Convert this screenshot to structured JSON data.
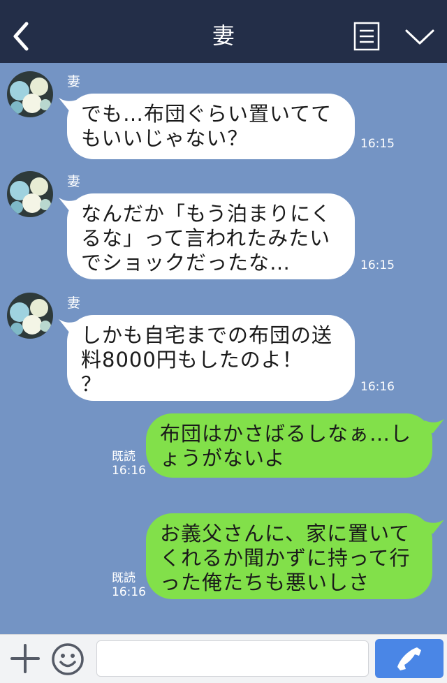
{
  "header": {
    "title": "妻",
    "back_icon": "chevron-left-icon",
    "menu_icon": "notes-menu-icon",
    "expand_icon": "chevron-down-icon"
  },
  "messages": [
    {
      "direction": "incoming",
      "sender": "妻",
      "text": "でも…布団ぐらい置いてて\nもいいじゃない？",
      "time": "16:15"
    },
    {
      "direction": "incoming",
      "sender": "妻",
      "text": "なんだか「もう泊まりにく\nるな」って言われたみたい\nでショックだったな…",
      "time": "16:15"
    },
    {
      "direction": "incoming",
      "sender": "妻",
      "text": "しかも自宅までの布団の送\n料8000円もしたのよ！\n？",
      "time": "16:16"
    },
    {
      "direction": "outgoing",
      "read": "既読",
      "text": "布団はかさばるしなぁ…し\nょうがないよ",
      "time": "16:16"
    },
    {
      "direction": "outgoing",
      "read": "既読",
      "text": "お義父さんに、家に置いて\nくれるか聞かずに持って行\nった俺たちも悪いしさ",
      "time": "16:16"
    }
  ],
  "input_bar": {
    "plus_icon": "plus-icon",
    "emoji_icon": "smiley-icon",
    "message_value": "",
    "call_icon": "phone-icon"
  },
  "colors": {
    "header_bg": "#232e48",
    "chat_bg": "#7494c4",
    "incoming_bubble": "#ffffff",
    "outgoing_bubble": "#82e04a",
    "call_button": "#4a86e6"
  }
}
